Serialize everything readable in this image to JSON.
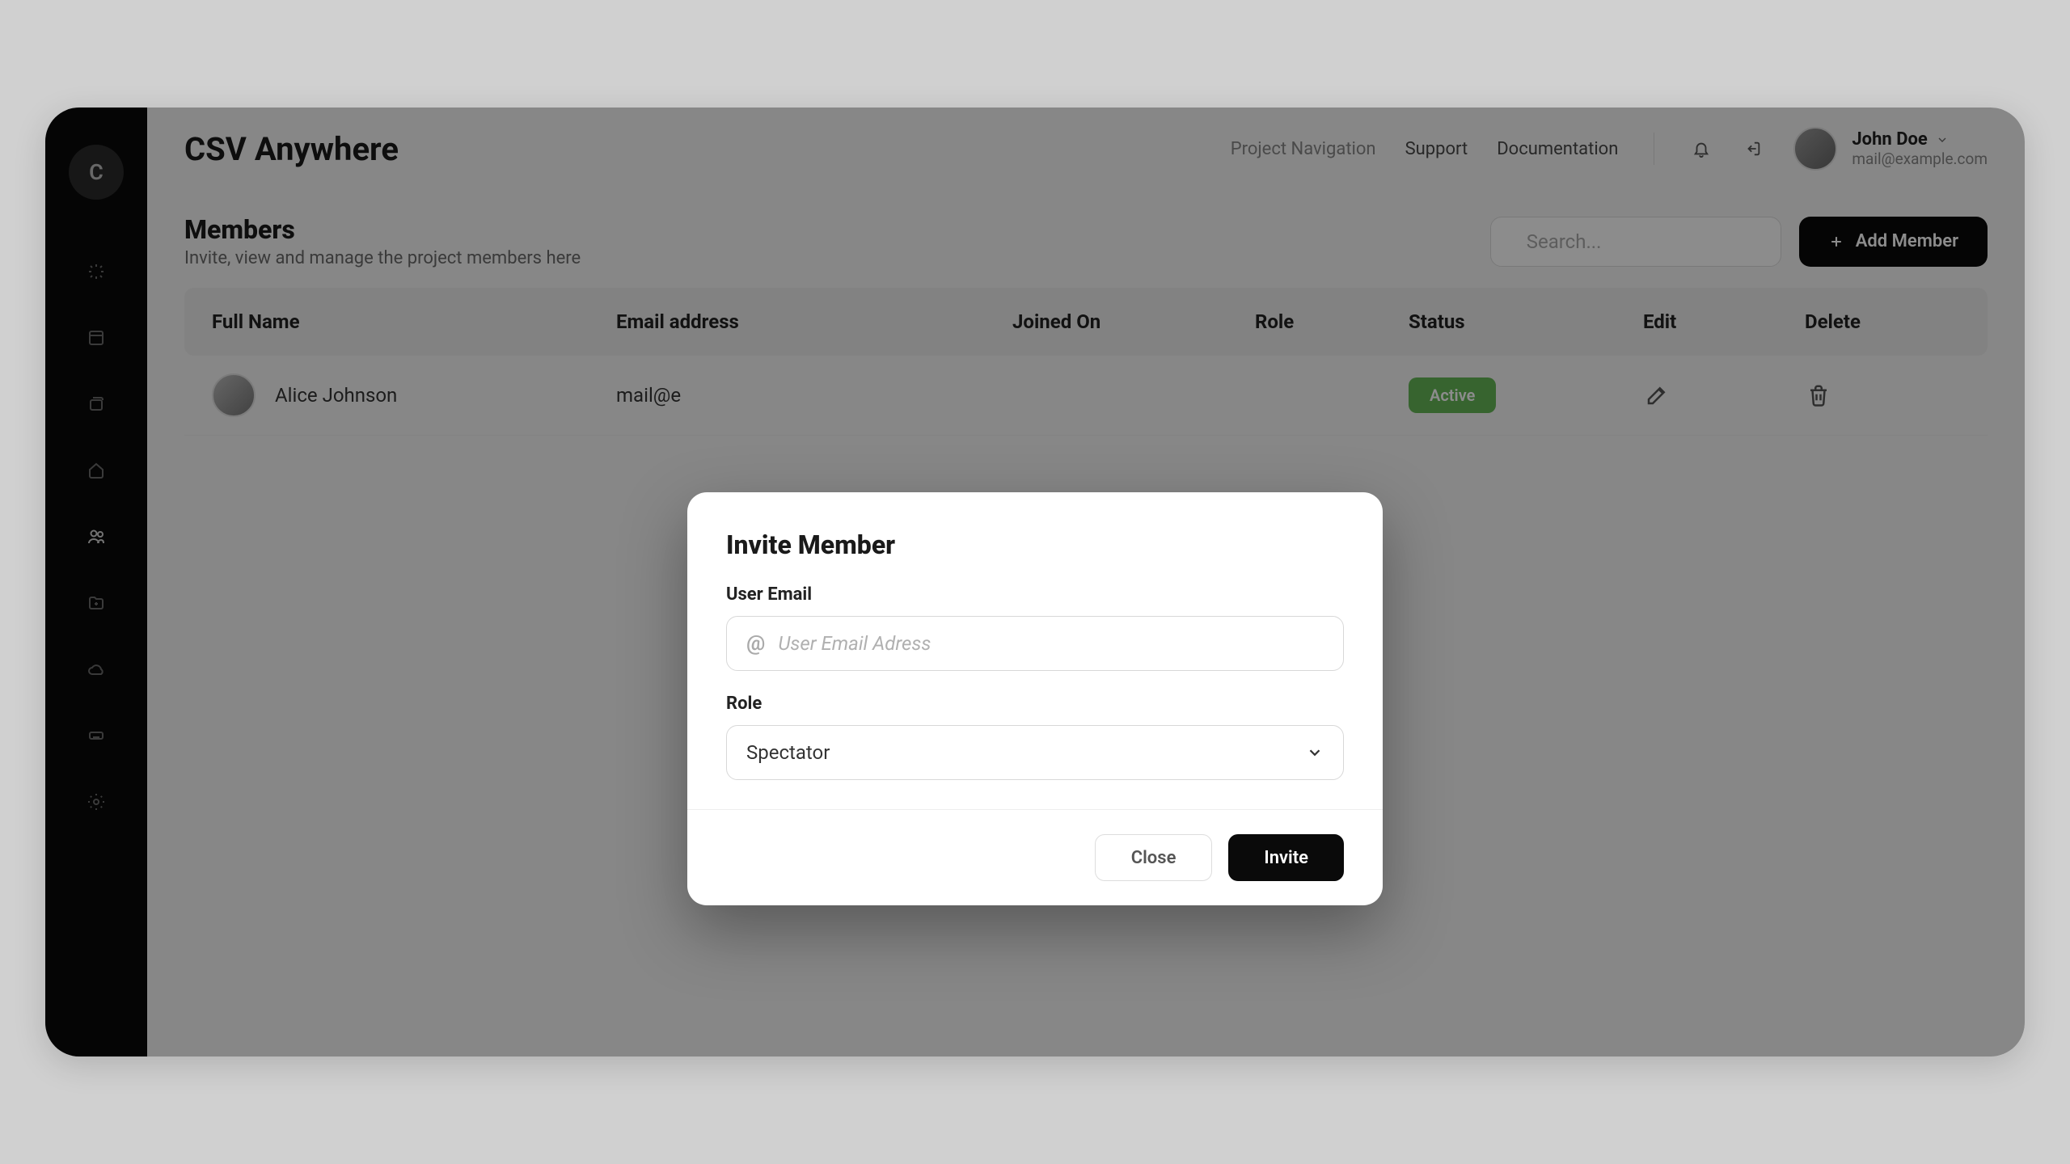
{
  "app": {
    "logo_letter": "C",
    "title": "CSV Anywhere"
  },
  "nav": {
    "project_nav": "Project Navigation",
    "support": "Support",
    "docs": "Documentation"
  },
  "user": {
    "name": "John Doe",
    "email": "mail@example.com"
  },
  "page": {
    "title": "Members",
    "subtitle": "Invite, view and manage the project members here",
    "search_placeholder": "Search...",
    "add_button": "Add Member"
  },
  "table": {
    "headers": {
      "name": "Full Name",
      "email": "Email address",
      "joined": "Joined On",
      "role": "Role",
      "status": "Status",
      "edit": "Edit",
      "delete": "Delete"
    },
    "rows": [
      {
        "name": "Alice Johnson",
        "email": "mail@e",
        "joined": "",
        "role": "",
        "status": "Active"
      }
    ]
  },
  "modal": {
    "title": "Invite Member",
    "email_label": "User Email",
    "email_placeholder": "User Email Adress",
    "role_label": "Role",
    "role_value": "Spectator",
    "close": "Close",
    "invite": "Invite"
  },
  "colors": {
    "status_active_bg": "#64b657",
    "primary_button": "#0a0a0a"
  }
}
